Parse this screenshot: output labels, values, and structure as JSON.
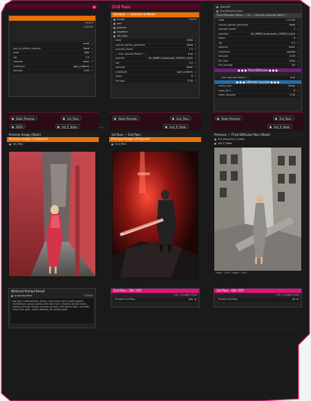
{
  "columns": {
    "col1": {
      "title": "",
      "top_toggle": "●"
    },
    "col2": {
      "title": "2nd Pass"
    },
    "col3": {
      "title": "Third Diffusion"
    }
  },
  "col1_node": {
    "outputs": [
      "IMAGE",
      "LATENT"
    ],
    "widgets": [
      {
        "label": "",
        "value": "none"
      },
      {
        "label": "pos_ss_before_upscale",
        "value": "fixed"
      },
      {
        "label": "seed",
        "value": "880"
      },
      {
        "label": "cfg",
        "value": "3.5"
      },
      {
        "label": "sampler",
        "value": "euler"
      },
      {
        "label": "scheduler",
        "value": "sgm_uniform"
      },
      {
        "label": "denoise",
        "value": "0.65"
      }
    ]
  },
  "col2_node": {
    "header": "Sampler — Upscale & Model",
    "inputs": [
      "model",
      "vae",
      "positive",
      "negative",
      "1st_Pass"
    ],
    "output": "IMAGE",
    "widgets": [
      {
        "label": "seed",
        "value": "1964"
      },
      {
        "label": "control_before_generate",
        "value": "fixed"
      },
      {
        "label": "upscale_factor",
        "value": "1.5"
      },
      {
        "label": "— Use Upscale Model ? —",
        "value": "true"
      },
      {
        "label": "upscale",
        "value": "8x_NMKD-Superscale_150000_G.pth"
      },
      {
        "label": "cfg",
        "value": "3.5"
      },
      {
        "label": "sampler",
        "value": "euler"
      },
      {
        "label": "scheduler",
        "value": "sgm_uniform"
      },
      {
        "label": "steps",
        "value": "8"
      },
      {
        "label": "denoise",
        "value": "0.35"
      }
    ]
  },
  "col3_node": {
    "inputs": [
      "Upscaler",
      "2nd_Pass/1st_Pass"
    ],
    "header": "Third Diffusion (Beta) — OK — Ultimate Upscale (Beta) ?",
    "widgets": [
      {
        "label": "seed",
        "value": "171126"
      },
      {
        "label": "control_before_generate",
        "value": "fixed"
      },
      {
        "label": "upscale_factor",
        "value": "2"
      },
      {
        "label": "upscaler",
        "value": "8x_NMKD-Superscale_150000_G.pth"
      },
      {
        "label": "steps",
        "value": "8"
      },
      {
        "label": "cfg",
        "value": "1.5"
      },
      {
        "label": "sampler",
        "value": "euler"
      },
      {
        "label": "scheduler",
        "value": "normal"
      },
      {
        "label": "denoise",
        "value": "0.25"
      },
      {
        "label": "tile_size",
        "value": "1024"
      },
      {
        "label": "tile_overlap",
        "value": "64"
      }
    ],
    "purple_bar": "● ● ● Third Diffusion ● ● ●",
    "use_upscale_label": "— Use Upscale Model ? —",
    "use_upscale_value": "true",
    "blue_bar": "● ● ● Ultimate Upscale ● ● ●",
    "extra": [
      {
        "label": "mode_type",
        "value": "Chess"
      },
      {
        "label": "mask_blur",
        "value": "8"
      },
      {
        "label": "seam_denoise",
        "value": "0.35"
      }
    ]
  },
  "strip1": {
    "stats": "Stats Preview",
    "link1": "1st_Pass",
    "link2": "1st_P_Stats",
    "data": "DATA"
  },
  "strip2": {
    "stats": "Stats Preview",
    "link1": "2nd_Pass",
    "link2": "2nd_P_Stats"
  },
  "strip3": {
    "stats": "Stats Preview",
    "link1": "3rd_Pass",
    "link2": "3rd_P_Stats"
  },
  "preview1": {
    "caption": "Preview Image (Stats)",
    "header": "Preview Image (1Outputs)",
    "input": "1st_Pass"
  },
  "preview2": {
    "caption": "1st Pass — 2nd Pass",
    "header": "Preview Image (2Outputs)",
    "input": "2nd_Pass"
  },
  "preview3": {
    "caption": "Previous — Third Diffusion Pass (Stats)",
    "inputs": [
      "3rd_Pass/2nd_P_Stats",
      "1st_P_Stats"
    ],
    "footer": "Pixels · 1536 · Height · 1024"
  },
  "prompt_box": {
    "caption": "Wildcard Prompt Result",
    "input": "promptoutline",
    "type": "STRING",
    "text": "big_logo, medieval/dark_theme, high angle shot of split brutalist architecture, young woman with wavy hair in flowing red silk dress, walking through narrow concrete corridor, soft natural light, cinematic mood, film grain, highly detailed, 8k quality photo"
  },
  "toggle2": {
    "header": "2nd Pass · ON / OFF",
    "opt": "OPT_CONNECTION",
    "label": "Enable 2nd Pass",
    "value": "yes"
  },
  "toggle3": {
    "header": "3rd Pass · ON / OFF",
    "opt": "OPT_CONNECTION",
    "label": "Enable 3rd Pass",
    "value": "no"
  },
  "colors": {
    "accent": "#e2127a",
    "border": "#ff2d8a",
    "orange": "#e8720a",
    "purple": "#7a1a86",
    "blue": "#1f6fb0"
  }
}
